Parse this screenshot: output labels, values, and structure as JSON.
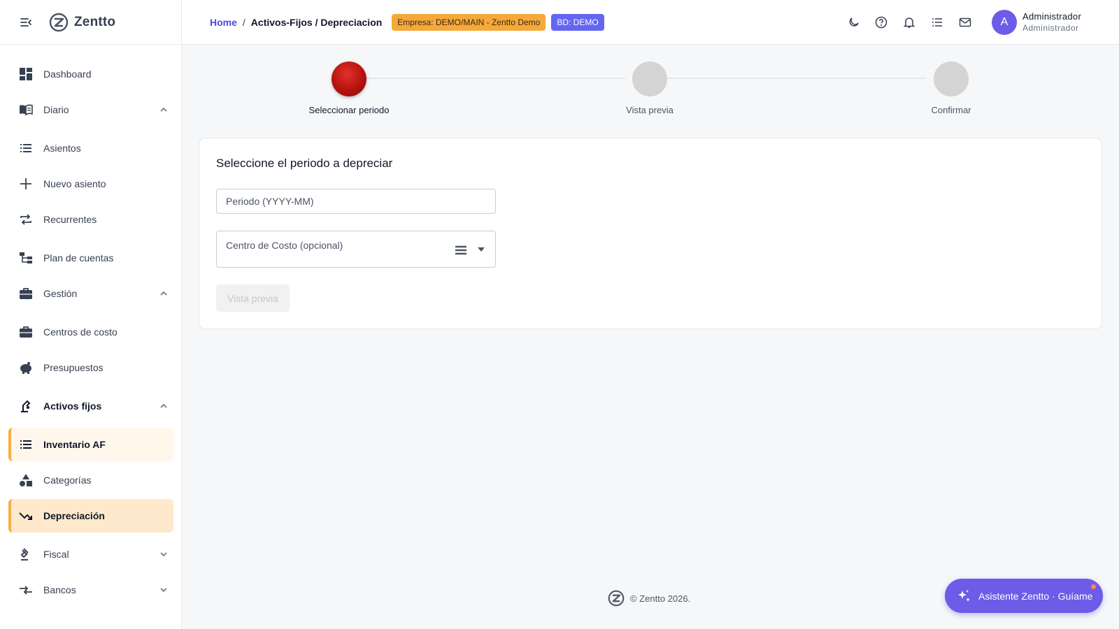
{
  "brand": {
    "name": "Zentto"
  },
  "sidebar": {
    "items": [
      {
        "label": "Dashboard",
        "icon": "dashboard-icon"
      },
      {
        "label": "Diario",
        "icon": "book-icon",
        "expanded": true
      },
      {
        "label": "Asientos",
        "icon": "list-icon"
      },
      {
        "label": "Nuevo asiento",
        "icon": "plus-icon"
      },
      {
        "label": "Recurrentes",
        "icon": "repeat-icon"
      },
      {
        "label": "Plan de cuentas",
        "icon": "account-tree-icon"
      },
      {
        "label": "Gestión",
        "icon": "briefcase-icon",
        "expanded": true
      },
      {
        "label": "Centros de costo",
        "icon": "briefcase-icon"
      },
      {
        "label": "Presupuestos",
        "icon": "piggy-bank-icon"
      },
      {
        "label": "Activos fijos",
        "icon": "precision-tool-icon",
        "expanded": true
      },
      {
        "label": "Inventario AF",
        "icon": "list-icon"
      },
      {
        "label": "Categorías",
        "icon": "category-icon"
      },
      {
        "label": "Depreciación",
        "icon": "trending-down-icon"
      },
      {
        "label": "Fiscal",
        "icon": "gavel-icon",
        "expanded": false
      },
      {
        "label": "Bancos",
        "icon": "compare-arrows-icon",
        "expanded": false
      }
    ]
  },
  "header": {
    "breadcrumb": {
      "home": "Home",
      "separator": "/",
      "current": "Activos-Fijos / Depreciacion"
    },
    "company_chip": "Empresa: DEMO/MAIN - Zentto Demo",
    "db_chip": "BD: DEMO",
    "user": {
      "initial": "A",
      "name": "Administrador",
      "role": "Administrador"
    }
  },
  "stepper": {
    "steps": [
      {
        "label": "Seleccionar periodo",
        "active": true
      },
      {
        "label": "Vista previa",
        "active": false
      },
      {
        "label": "Confirmar",
        "active": false
      }
    ]
  },
  "form": {
    "title": "Seleccione el periodo a depreciar",
    "period_placeholder": "Periodo (YYYY-MM)",
    "cost_center_label": "Centro de Costo (opcional)",
    "preview_button": "Vista previa"
  },
  "footer": {
    "copyright": "© Zentto 2026."
  },
  "assistant": {
    "label": "Asistente Zentto · Guíame"
  },
  "colors": {
    "accent": "#6c5ce7",
    "active_step": "#b5120f",
    "active_nav_border": "#f5b041",
    "company_chip": "#f5a93a",
    "db_chip": "#6366f1"
  }
}
